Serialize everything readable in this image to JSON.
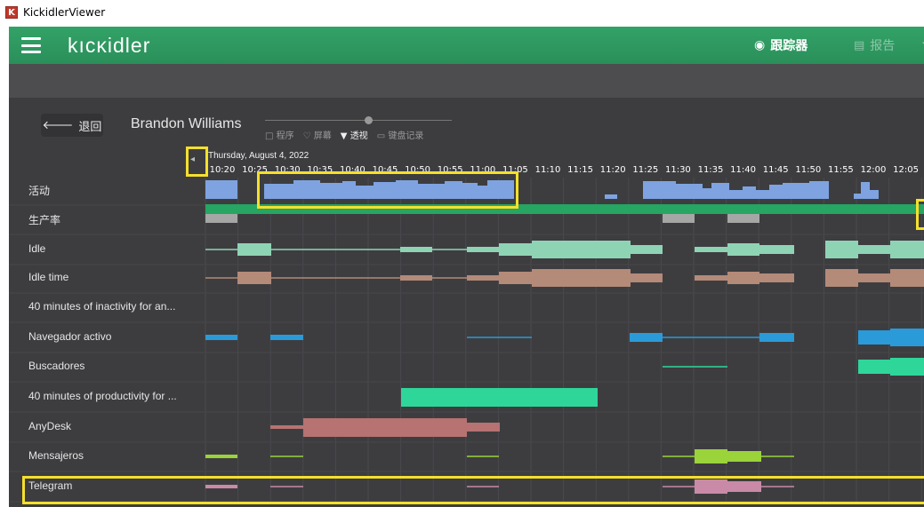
{
  "window": {
    "title": "KickidlerViewer",
    "icon_letter": "K"
  },
  "topbar": {
    "logo": "KICKIDLER",
    "logo_display": "kıcκidler",
    "nav_tracker": "跟踪器",
    "nav_report": "报告"
  },
  "toolbar": {
    "back_label": "退回",
    "user_name": "Brandon Williams",
    "view_toggles": [
      {
        "icon": "□",
        "label": "程序"
      },
      {
        "icon": "♡",
        "label": "屏幕"
      },
      {
        "icon": "▼",
        "label": "透视"
      },
      {
        "icon": "▭",
        "label": "键盘记录"
      }
    ]
  },
  "timeline": {
    "date": "Thursday, August 4, 2022",
    "ticks": [
      "10:20",
      "10:25",
      "10:30",
      "10:35",
      "10:40",
      "10:45",
      "10:50",
      "10:55",
      "11:00",
      "11:05",
      "11:10",
      "11:15",
      "11:20",
      "11:25",
      "11:30",
      "11:35",
      "11:40",
      "11:45",
      "11:50",
      "11:55",
      "12:00",
      "12:05"
    ],
    "rows": [
      {
        "label": "活动"
      },
      {
        "label": "生产率"
      },
      {
        "label": "Idle"
      },
      {
        "label": "Idle time"
      },
      {
        "label": "40 minutes of inactivity for an..."
      },
      {
        "label": "Navegador activo"
      },
      {
        "label": "Buscadores"
      },
      {
        "label": "40 minutes of productivity for ..."
      },
      {
        "label": "AnyDesk"
      },
      {
        "label": "Mensajeros"
      },
      {
        "label": "Telegram"
      }
    ]
  },
  "colors": {
    "activity": "#7ea3e0",
    "productivity": "#27a562",
    "productivity_gap": "#a6a6a6",
    "idle": "#8fd3b5",
    "idle_time": "#b48a78",
    "navegador": "#2b9ad8",
    "buscadores": "#2fd69a",
    "productivity40": "#2fd69a",
    "anydesk": "#b77272",
    "mensajeros": "#9ad33a",
    "telegram": "#c98aa8",
    "highlight": "#f4e02c"
  }
}
